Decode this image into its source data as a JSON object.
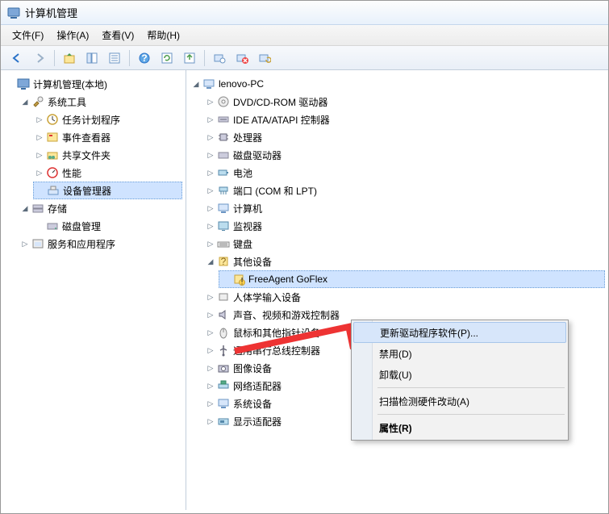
{
  "window": {
    "title": "计算机管理"
  },
  "menubar": {
    "file": "文件(F)",
    "action": "操作(A)",
    "view": "查看(V)",
    "help": "帮助(H)"
  },
  "leftTree": {
    "root": "计算机管理(本地)",
    "systemTools": "系统工具",
    "taskScheduler": "任务计划程序",
    "eventViewer": "事件查看器",
    "sharedFolders": "共享文件夹",
    "performance": "性能",
    "deviceManager": "设备管理器",
    "storage": "存储",
    "diskMgmt": "磁盘管理",
    "services": "服务和应用程序"
  },
  "rightTree": {
    "root": "lenovo-PC",
    "dvd": "DVD/CD-ROM 驱动器",
    "ide": "IDE ATA/ATAPI 控制器",
    "cpu": "处理器",
    "disk": "磁盘驱动器",
    "battery": "电池",
    "ports": "端口 (COM 和 LPT)",
    "computer": "计算机",
    "monitor": "监视器",
    "keyboard": "键盘",
    "other": "其他设备",
    "otherChild": "FreeAgent GoFlex",
    "hid": "人体学输入设备",
    "sound": "声音、视频和游戏控制器",
    "mouse": "鼠标和其他指针设备",
    "usb": "通用串行总线控制器",
    "imaging": "图像设备",
    "network": "网络适配器",
    "system": "系统设备",
    "display": "显示适配器"
  },
  "contextMenu": {
    "update": "更新驱动程序软件(P)...",
    "disable": "禁用(D)",
    "uninstall": "卸载(U)",
    "scan": "扫描检测硬件改动(A)",
    "properties": "属性(R)"
  }
}
